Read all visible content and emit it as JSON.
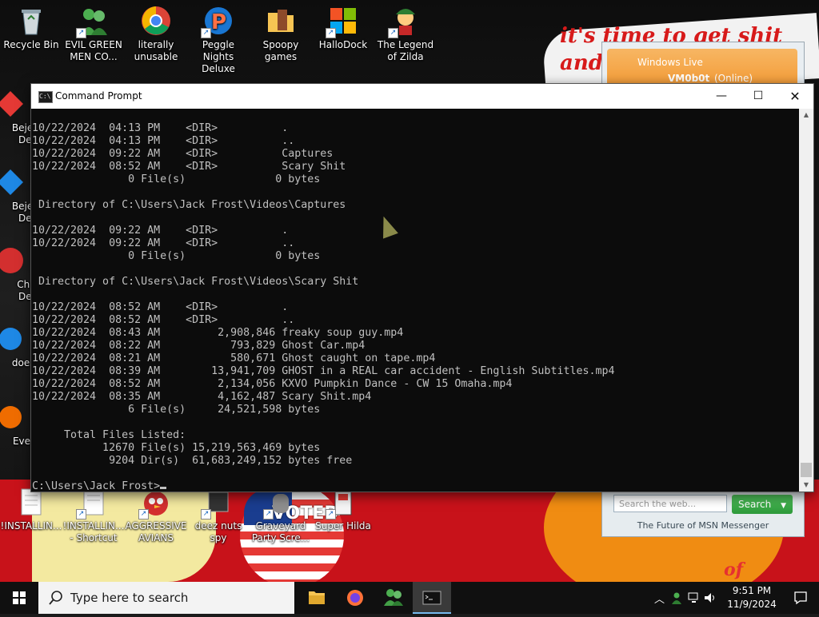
{
  "wallpaper": {
    "scrawl_line1": "it's time to get shit",
    "scrawl_line2": "and",
    "flag_text": "VOTED",
    "pumpkin_text": "of"
  },
  "desktop_icons": [
    {
      "label": "Recycle Bin",
      "icon": "recycle-bin-icon"
    },
    {
      "label": "EVIL GREEN MEN CO...",
      "icon": "messenger-buddies-icon"
    },
    {
      "label": "literally unusable",
      "icon": "chrome-icon"
    },
    {
      "label": "Peggle Nights Deluxe",
      "icon": "peggle-icon"
    },
    {
      "label": "Spoopy games",
      "icon": "folder-icon"
    },
    {
      "label": "HalloDock",
      "icon": "windows-logo-icon"
    },
    {
      "label": "The Legend of Zilda",
      "icon": "zilda-icon"
    }
  ],
  "left_icons": [
    {
      "label": "Bejew Del",
      "icon": "bejeweled-icon"
    },
    {
      "label": "Bejew Del",
      "icon": "bejeweled-icon"
    },
    {
      "label": "Chu Del",
      "icon": "chuzzle-icon"
    },
    {
      "label": "doesn",
      "icon": "app-icon"
    },
    {
      "label": "Every",
      "icon": "app-icon"
    }
  ],
  "bottom_icons": [
    {
      "label": "!INSTALLIN...",
      "icon": "document-icon"
    },
    {
      "label": "!INSTALLIN... - Shortcut",
      "icon": "document-icon"
    },
    {
      "label": "AGGRESSIVE AVIANS",
      "icon": "angry-bird-icon"
    },
    {
      "label": "deez nuts spy",
      "icon": "app-icon"
    },
    {
      "label": "Graveyard Party Scre...",
      "icon": "game-icon"
    },
    {
      "label": "Super Hilda",
      "icon": "game-icon"
    }
  ],
  "messenger": {
    "title": "Windows Live",
    "username": "VM0b0t",
    "status": "(Online)",
    "search_placeholder": "Search the web...",
    "search_button": "Search",
    "tagline": "The Future of MSN Messenger"
  },
  "cmd": {
    "title": "Command Prompt",
    "lines": [
      "10/22/2024  04:13 PM    <DIR>          .",
      "10/22/2024  04:13 PM    <DIR>          ..",
      "10/22/2024  09:22 AM    <DIR>          Captures",
      "10/22/2024  08:52 AM    <DIR>          Scary Shit",
      "               0 File(s)              0 bytes",
      "",
      " Directory of C:\\Users\\Jack Frost\\Videos\\Captures",
      "",
      "10/22/2024  09:22 AM    <DIR>          .",
      "10/22/2024  09:22 AM    <DIR>          ..",
      "               0 File(s)              0 bytes",
      "",
      " Directory of C:\\Users\\Jack Frost\\Videos\\Scary Shit",
      "",
      "10/22/2024  08:52 AM    <DIR>          .",
      "10/22/2024  08:52 AM    <DIR>          ..",
      "10/22/2024  08:43 AM         2,908,846 freaky soup guy.mp4",
      "10/22/2024  08:22 AM           793,829 Ghost Car.mp4",
      "10/22/2024  08:21 AM           580,671 Ghost caught on tape.mp4",
      "10/22/2024  08:39 AM        13,941,709 GHOST in a REAL car accident - English Subtitles.mp4",
      "10/22/2024  08:52 AM         2,134,056 KXVO Pumpkin Dance - CW 15 Omaha.mp4",
      "10/22/2024  08:35 AM         4,162,487 Scary Shit.mp4",
      "               6 File(s)     24,521,598 bytes",
      "",
      "     Total Files Listed:",
      "           12670 File(s) 15,219,563,469 bytes",
      "            9204 Dir(s)  61,683,249,152 bytes free",
      "",
      "C:\\Users\\Jack Frost>"
    ]
  },
  "taskbar": {
    "search_placeholder": "Type here to search",
    "time": "9:51 PM",
    "date": "11/9/2024"
  }
}
